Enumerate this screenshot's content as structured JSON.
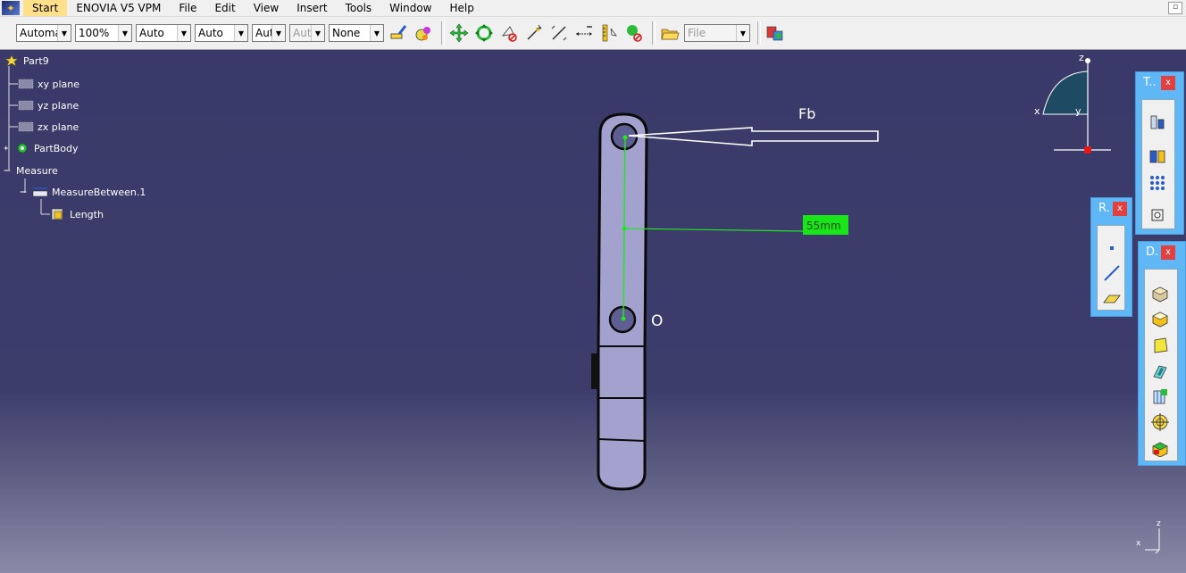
{
  "menu": {
    "items": [
      {
        "label": "Start",
        "active": true
      },
      {
        "label": "ENOVIA V5 VPM",
        "active": false
      },
      {
        "label": "File",
        "active": false
      },
      {
        "label": "Edit",
        "active": false
      },
      {
        "label": "View",
        "active": false
      },
      {
        "label": "Insert",
        "active": false
      },
      {
        "label": "Tools",
        "active": false
      },
      {
        "label": "Window",
        "active": false
      },
      {
        "label": "Help",
        "active": false
      }
    ]
  },
  "toolbar": {
    "combos": [
      {
        "value": "Automa",
        "disabled": false
      },
      {
        "value": "100%",
        "disabled": false
      },
      {
        "value": "Auto",
        "disabled": false
      },
      {
        "value": "Auto",
        "disabled": false
      },
      {
        "value": "Aut",
        "disabled": false
      },
      {
        "value": "Aut",
        "disabled": true
      },
      {
        "value": "None",
        "disabled": false
      }
    ],
    "file_combo": {
      "value": "File"
    }
  },
  "tree": {
    "root": "Part9",
    "planes": [
      "xy plane",
      "yz plane",
      "zx plane"
    ],
    "body": "PartBody",
    "measure": "Measure",
    "measure_between": "MeasureBetween.1",
    "length": "Length"
  },
  "viewport": {
    "force_label": "Fb",
    "origin_label": "O",
    "dimension": "55mm",
    "compass_axes": {
      "x": "x",
      "y": "y",
      "z": "z"
    },
    "mini_axes": {
      "x": "x",
      "z": "z"
    }
  },
  "panels": {
    "tools": {
      "title": "T..",
      "close": "x"
    },
    "reference": {
      "title": "R.",
      "close": "x"
    },
    "dress": {
      "title": "D.",
      "close": "x"
    }
  },
  "colors": {
    "background": "#3c3b6e",
    "measure_green": "#19e619",
    "panel_blue": "#5fb7f6",
    "close_red": "#e04040"
  }
}
